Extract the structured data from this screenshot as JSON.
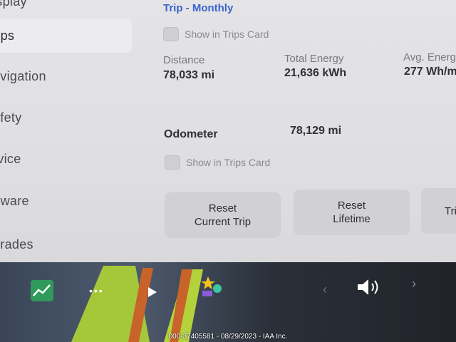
{
  "sidebar": {
    "items": [
      {
        "label": "isplay"
      },
      {
        "label": "rips"
      },
      {
        "label": "avigation"
      },
      {
        "label": "afety"
      },
      {
        "label": "rvice"
      },
      {
        "label": "ftware"
      },
      {
        "label": "grades"
      }
    ]
  },
  "trips": {
    "title": "Trip - Monthly",
    "show_in_trips_card": "Show in Trips Card",
    "distance": {
      "label": "Distance",
      "value": "78,033 mi"
    },
    "total_energy": {
      "label": "Total Energy",
      "value": "21,636 kWh"
    },
    "avg_energy": {
      "label": "Avg. Energ",
      "value": "277 Wh/m"
    },
    "odometer": {
      "label": "Odometer",
      "value": "78,129 mi"
    },
    "odometer_show_in_trips_card": "Show in Trips Card"
  },
  "buttons": {
    "reset_current_trip": {
      "line1": "Reset",
      "line2": "Current Trip"
    },
    "reset_lifetime": {
      "line1": "Reset",
      "line2": "Lifetime"
    },
    "partial": "Tri"
  },
  "dock": {
    "icons": [
      "stocks-icon",
      "more-dots-icon",
      "play-icon",
      "toybox-icon",
      "chevron-left-icon",
      "volume-icon",
      "chevron-right-icon"
    ]
  },
  "watermark": "000-37405581 - 08/29/2023 - IAA Inc.",
  "colors": {
    "accent": "#3c63c9",
    "panel": "#e4e4e6",
    "button": "#d1d1d4"
  }
}
